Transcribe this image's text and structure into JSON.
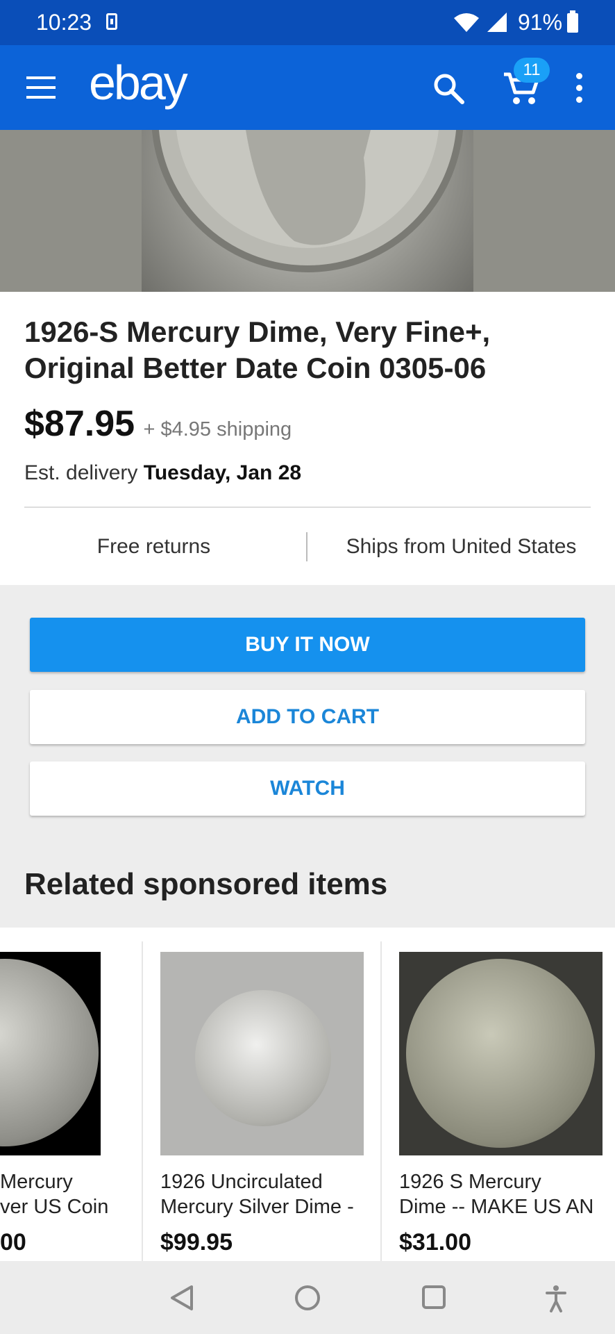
{
  "status_bar": {
    "time": "10:23",
    "battery": "91%"
  },
  "app_bar": {
    "logo": "ebay",
    "cart_count": "11"
  },
  "product": {
    "title": "1926-S Mercury Dime, Very Fine+, Original Better Date Coin   0305-06",
    "price": "$87.95",
    "shipping": "+ $4.95 shipping",
    "delivery_label": "Est. delivery",
    "delivery_date": "Tuesday, Jan 28",
    "returns": "Free returns",
    "ships_from": "Ships from United States"
  },
  "actions": {
    "buy_now": "BUY IT NOW",
    "add_to_cart": "ADD TO CART",
    "watch": "WATCH"
  },
  "related": {
    "heading": "Related sponsored items",
    "items": [
      {
        "name_line1": "Mercury",
        "name_line2": "ver US Coin",
        "price": "00"
      },
      {
        "name_line1": "1926  Uncirculated",
        "name_line2": "Mercury Silver Dime -",
        "price": "$99.95"
      },
      {
        "name_line1": "1926 S Mercury",
        "name_line2": "Dime  --  MAKE US AN",
        "price": "$31.00"
      }
    ]
  },
  "colors": {
    "status_bar": "#0a4eb8",
    "app_bar": "#0c63d8",
    "buy_button": "#1591ee",
    "link_blue": "#1b86d8",
    "badge": "#1aa0f7"
  },
  "icons": [
    "menu-icon",
    "search-icon",
    "cart-icon",
    "overflow-menu-icon",
    "wifi-icon",
    "signal-icon",
    "battery-icon",
    "back-nav-icon",
    "home-nav-icon",
    "recents-nav-icon",
    "accessibility-icon"
  ]
}
